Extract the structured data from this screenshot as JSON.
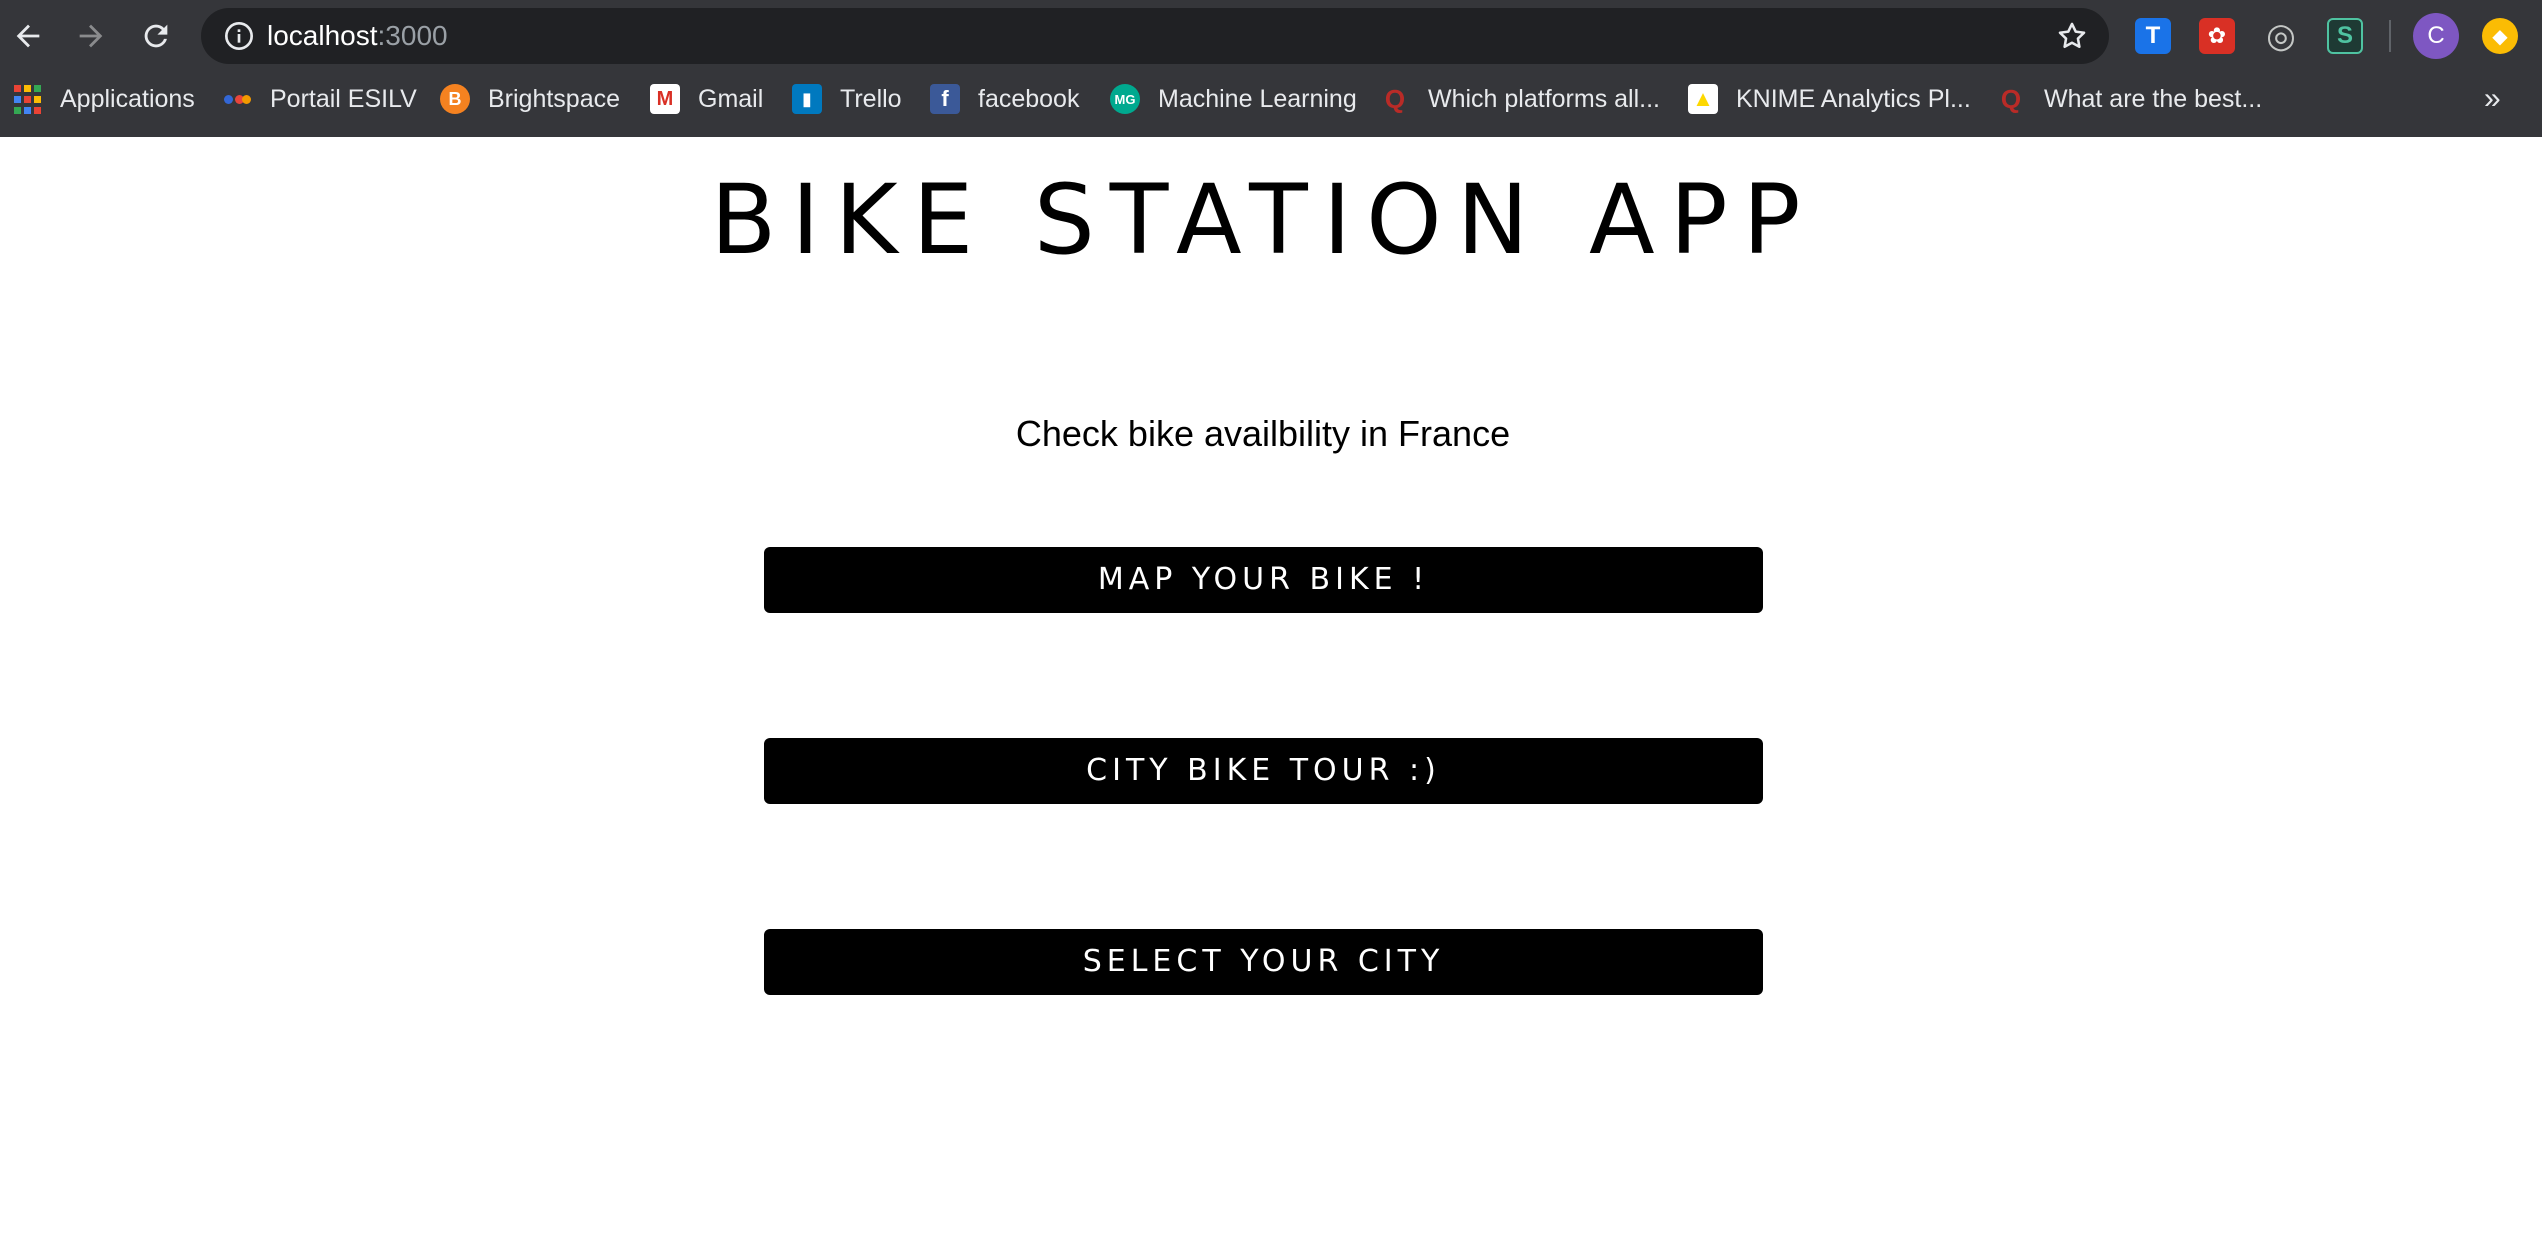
{
  "browser": {
    "url_host": "localhost",
    "url_port": ":3000",
    "toolbar_icons": [
      "back-arrow-icon",
      "forward-arrow-icon",
      "reload-icon",
      "info-icon",
      "star-icon"
    ],
    "extensions": [
      {
        "name": "translate-extension-icon",
        "glyph": "T",
        "color": "#1a73e8"
      },
      {
        "name": "red-extension-icon",
        "glyph": "✿",
        "color": "#d93025"
      },
      {
        "name": "target-extension-icon",
        "glyph": "◎",
        "color": "#5f6368"
      },
      {
        "name": "s-extension-icon",
        "glyph": "S",
        "color": "#1e8e3e"
      }
    ],
    "profile_initial": "C",
    "bookmarks": [
      {
        "label": "Applications",
        "icon": "apps-grid-icon"
      },
      {
        "label": "Portail ESILV",
        "icon": "portail-esilv-icon"
      },
      {
        "label": "Brightspace",
        "icon": "brightspace-icon"
      },
      {
        "label": "Gmail",
        "icon": "gmail-icon"
      },
      {
        "label": "Trello",
        "icon": "trello-icon"
      },
      {
        "label": "facebook",
        "icon": "facebook-icon"
      },
      {
        "label": "Machine Learning",
        "icon": "machine-learning-icon"
      },
      {
        "label": "Which platforms all...",
        "icon": "quora-icon"
      },
      {
        "label": "KNIME Analytics Pl...",
        "icon": "knime-icon"
      },
      {
        "label": "What are the best...",
        "icon": "quora-icon"
      }
    ],
    "overflow_label": "»"
  },
  "page": {
    "title": "BIKE STATION APP",
    "subtitle": "Check bike availbility in France",
    "buttons": [
      {
        "label": "MAP YOUR BIKE !"
      },
      {
        "label": "CITY BIKE TOUR :)"
      },
      {
        "label": "SELECT YOUR CITY"
      }
    ]
  },
  "colors": {
    "chrome_bg": "#35363a",
    "omnibox_bg": "#202124",
    "button_bg": "#000000",
    "button_text": "#ffffff",
    "page_bg": "#ffffff"
  }
}
